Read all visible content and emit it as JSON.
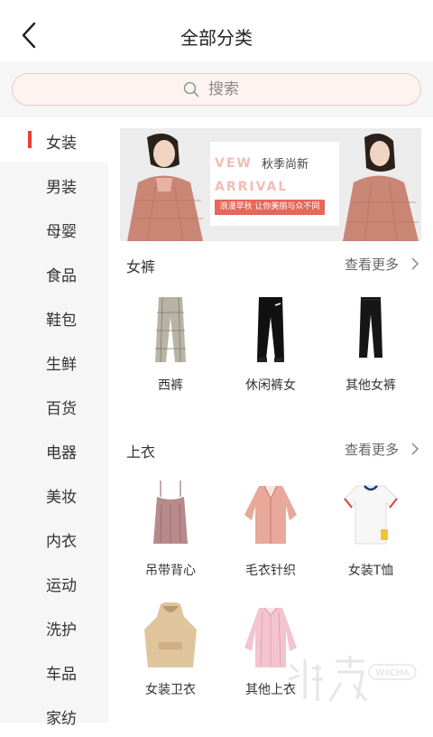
{
  "header": {
    "title": "全部分类"
  },
  "search": {
    "placeholder": "搜索"
  },
  "sidebar": {
    "items": [
      {
        "label": "女装",
        "active": true
      },
      {
        "label": "男装"
      },
      {
        "label": "母婴"
      },
      {
        "label": "食品"
      },
      {
        "label": "鞋包"
      },
      {
        "label": "生鲜"
      },
      {
        "label": "百货"
      },
      {
        "label": "电器"
      },
      {
        "label": "美妆"
      },
      {
        "label": "内衣"
      },
      {
        "label": "运动"
      },
      {
        "label": "洗护"
      },
      {
        "label": "车品"
      },
      {
        "label": "家纺"
      }
    ]
  },
  "banner": {
    "en_line1": "VEW",
    "en_line2": "ARRIVAL",
    "cn_title": "秋季尚新",
    "tagline": "浪漫早秋 让你美丽与众不同"
  },
  "sections": [
    {
      "title": "女裤",
      "more": "查看更多",
      "items": [
        "西裤",
        "休闲裤女",
        "其他女裤"
      ]
    },
    {
      "title": "上衣",
      "more": "查看更多",
      "items": [
        "吊带背心",
        "毛衣针织",
        "女装T恤",
        "女装卫衣",
        "其他上衣"
      ]
    }
  ],
  "watermark": {
    "text": "WXCHA"
  },
  "colors": {
    "accent": "#e8412f",
    "sidebar_bg": "#f6f6f6",
    "search_border": "#f0c7c1"
  }
}
